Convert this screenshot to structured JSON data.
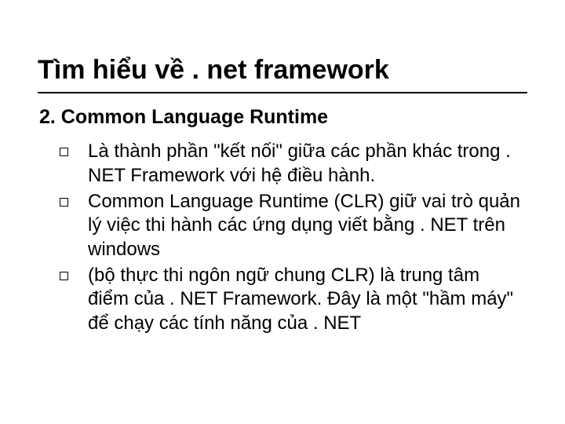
{
  "slide": {
    "title": "Tìm hiểu về . net framework",
    "subtitle": "2. Common Language Runtime",
    "bullets": [
      "Là thành phần \"kết nối\" giữa các phần khác trong . NET Framework với hệ điều hành.",
      "Common Language Runtime (CLR) giữ vai trò quản lý việc thi hành các ứng dụng viết bằng . NET trên windows",
      "(bộ thực thi ngôn ngữ chung CLR) là trung tâm điểm của . NET Framework. Đây là một \"hầm máy\" để chạy các tính năng của . NET"
    ]
  }
}
